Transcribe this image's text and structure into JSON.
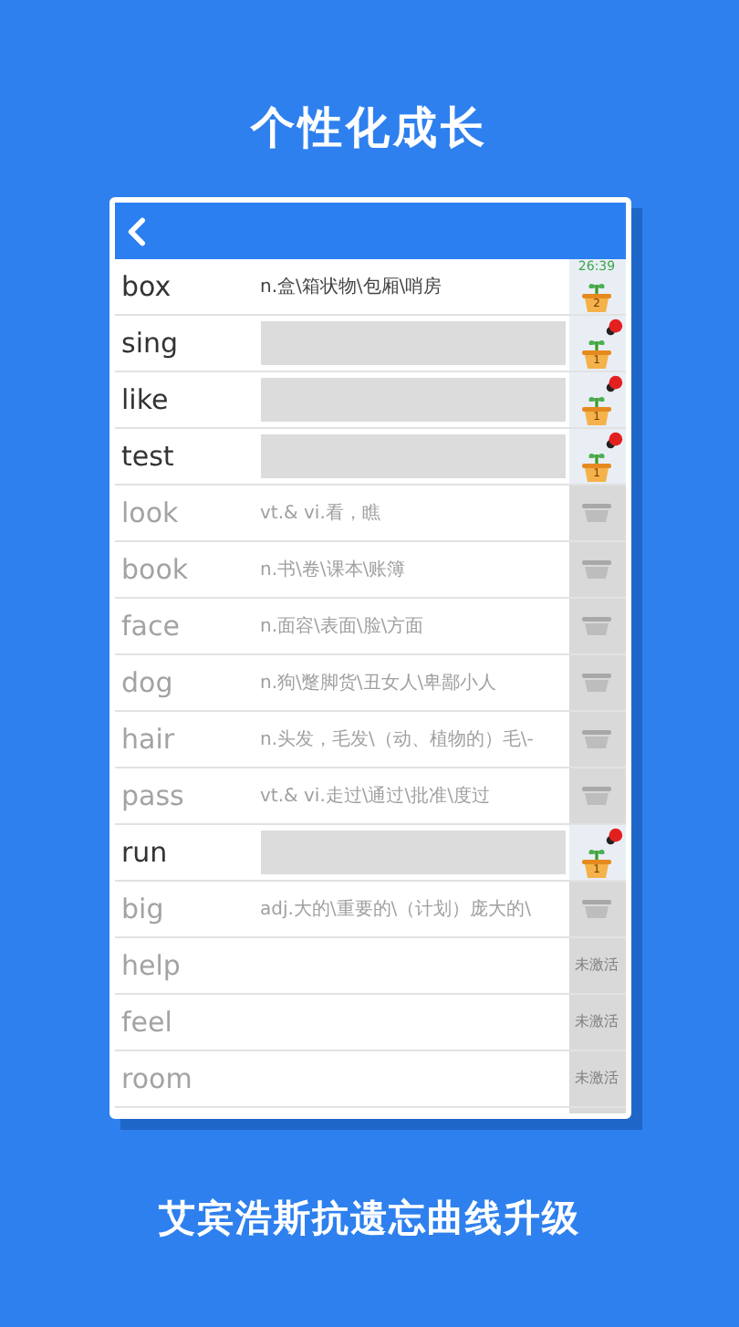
{
  "heading": "个性化成长",
  "rows": [
    {
      "word": "box",
      "kind": "growing",
      "meaning": "n.盒\\箱状物\\包厢\\哨房",
      "meaning_hidden": false,
      "timer": "26:39",
      "pot_label": "2",
      "bug": false
    },
    {
      "word": "sing",
      "kind": "growing",
      "meaning_hidden": true,
      "pot_label": "1",
      "bug": true
    },
    {
      "word": "like",
      "kind": "growing",
      "meaning_hidden": true,
      "pot_label": "1",
      "bug": true
    },
    {
      "word": "test",
      "kind": "growing",
      "meaning_hidden": true,
      "pot_label": "1",
      "bug": true
    },
    {
      "word": "look",
      "kind": "idle",
      "meaning": "vt.& vi.看，瞧"
    },
    {
      "word": "book",
      "kind": "idle",
      "meaning": "n.书\\卷\\课本\\账簿"
    },
    {
      "word": "face",
      "kind": "idle",
      "meaning": "n.面容\\表面\\脸\\方面"
    },
    {
      "word": "dog",
      "kind": "idle",
      "meaning": "n.狗\\蹩脚货\\丑女人\\卑鄙小人"
    },
    {
      "word": "hair",
      "kind": "idle",
      "meaning": "n.头发，毛发\\（动、植物的）毛\\-"
    },
    {
      "word": "pass",
      "kind": "idle",
      "meaning": "vt.& vi.走过\\通过\\批准\\度过"
    },
    {
      "word": "run",
      "kind": "growing",
      "meaning_hidden": true,
      "pot_label": "1",
      "bug": true
    },
    {
      "word": "big",
      "kind": "idle",
      "meaning": "adj.大的\\重要的\\（计划）庞大的\\"
    },
    {
      "word": "help",
      "kind": "inactive",
      "status": "未激活"
    },
    {
      "word": "feel",
      "kind": "inactive",
      "status": "未激活"
    },
    {
      "word": "room",
      "kind": "inactive",
      "status": "未激活"
    }
  ],
  "footer": "艾宾浩斯抗遗忘曲线升级"
}
